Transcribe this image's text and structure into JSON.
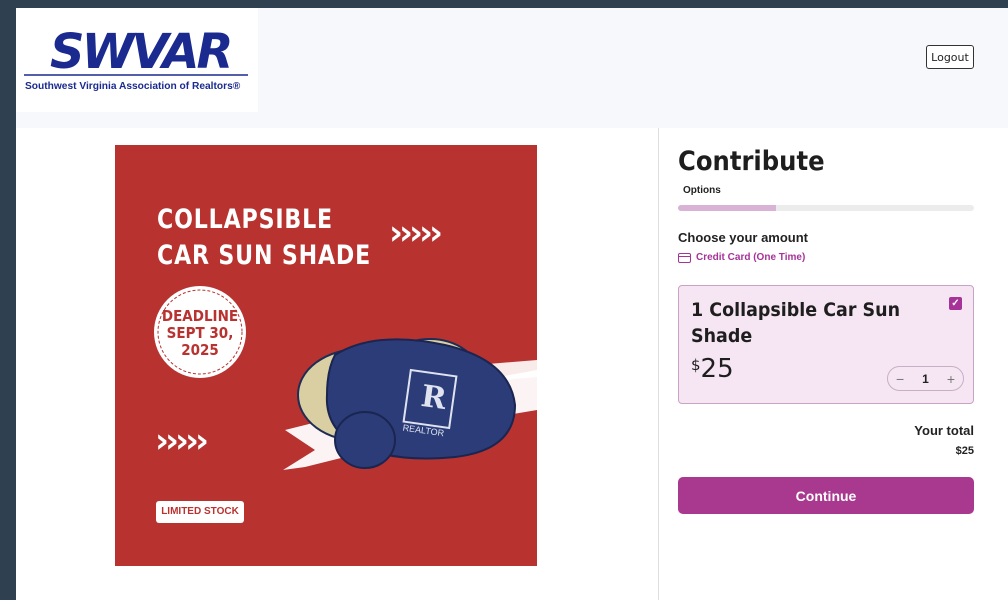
{
  "header": {
    "logo_text": "SWVAR",
    "logo_subtitle": "Southwest Virginia Association of Realtors®",
    "logout_label": "Logout"
  },
  "promo": {
    "title_line1": "COLLAPSIBLE",
    "title_line2": "CAR SUN SHADE",
    "chevrons": "›››››",
    "deadline_line1": "DEADLINE",
    "deadline_line2": "SEPT 30,",
    "deadline_line3": "2025",
    "badge": "LIMITED STOCK",
    "product_mark": "REALTOR"
  },
  "contribute": {
    "title": "Contribute",
    "step_label": "Options",
    "progress": 0.33,
    "choose_label": "Choose your amount",
    "payment_method": "Credit Card (One Time)",
    "option": {
      "name": "1 Collapsible Car Sun Shade",
      "currency": "$",
      "amount": "25",
      "quantity": "1",
      "checked": true
    },
    "total_label": "Your total",
    "total_value": "$25",
    "continue_label": "Continue"
  },
  "colors": {
    "accent": "#a9388f",
    "promo_bg": "#b83230",
    "logo_blue": "#1b2a8f"
  },
  "icons": [
    "credit-card-icon",
    "checkbox-check-icon",
    "minus-icon",
    "plus-icon"
  ]
}
